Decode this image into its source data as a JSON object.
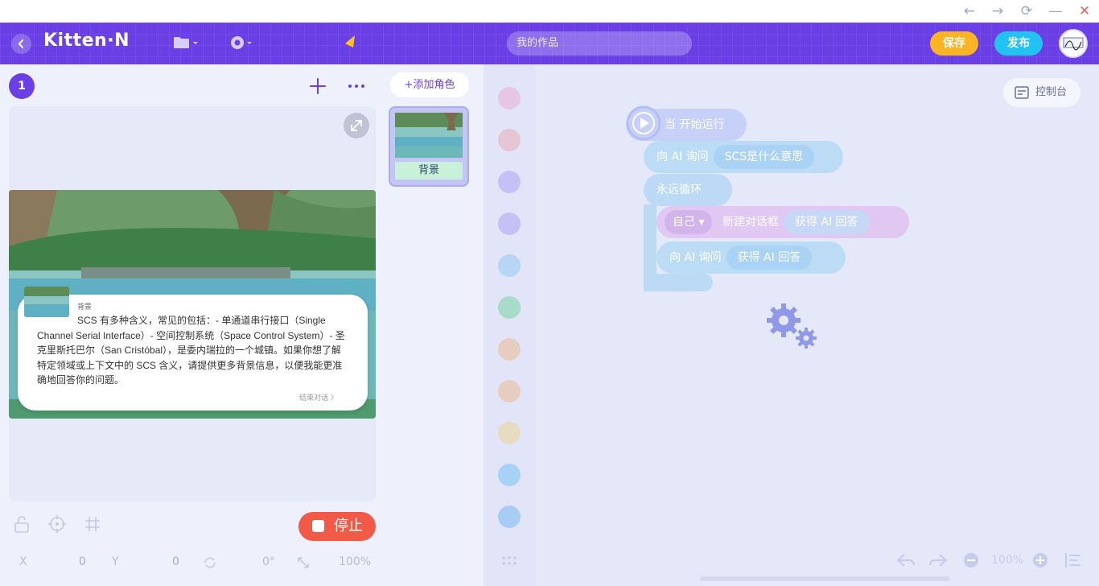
{
  "window": {
    "back": "←",
    "forward": "→",
    "refresh": "⟳",
    "minimize": "—",
    "close": "✕"
  },
  "header": {
    "logo": "Kitten·N",
    "search_placeholder": "我的作品",
    "save_label": "保存",
    "publish_label": "发布",
    "colors": {
      "bar": "#6b3fe6",
      "save": "#fbb424",
      "publish": "#22c3f0"
    }
  },
  "stage": {
    "badge": "1",
    "dialog": {
      "name": "背景",
      "text": "SCS 有多种含义，常见的包括：- 单通道串行接口（Single Channel Serial Interface）- 空间控制系统（Space Control System）- 圣克里斯托巴尔（San Cristóbal），是委内瑞拉的一个城镇。如果你想了解特定领域或上下文中的 SCS 含义，请提供更多背景信息，以便我能更准确地回答你的问题。",
      "end_label": "结束对话 〉"
    },
    "stop_label": "停止",
    "status": {
      "x_label": "X",
      "x_value": "0",
      "y_label": "Y",
      "y_value": "0",
      "rotation": "0°",
      "scale": "100%"
    }
  },
  "roles": {
    "add_label": "+添加角色",
    "items": [
      {
        "label": "背景"
      }
    ]
  },
  "code": {
    "console_label": "控制台",
    "blocks": {
      "start": "当 开始运行",
      "ask1_prefix": "向 AI 询问",
      "ask1_value": "SCS是什么意思",
      "forever": "永远循环",
      "dialog_target": "自己",
      "dialog_mid": "新建对话框",
      "dialog_value": "获得 AI 回答",
      "ask2_prefix": "向 AI 询问",
      "ask2_value": "获得 AI 回答"
    },
    "zoom": "100%"
  }
}
